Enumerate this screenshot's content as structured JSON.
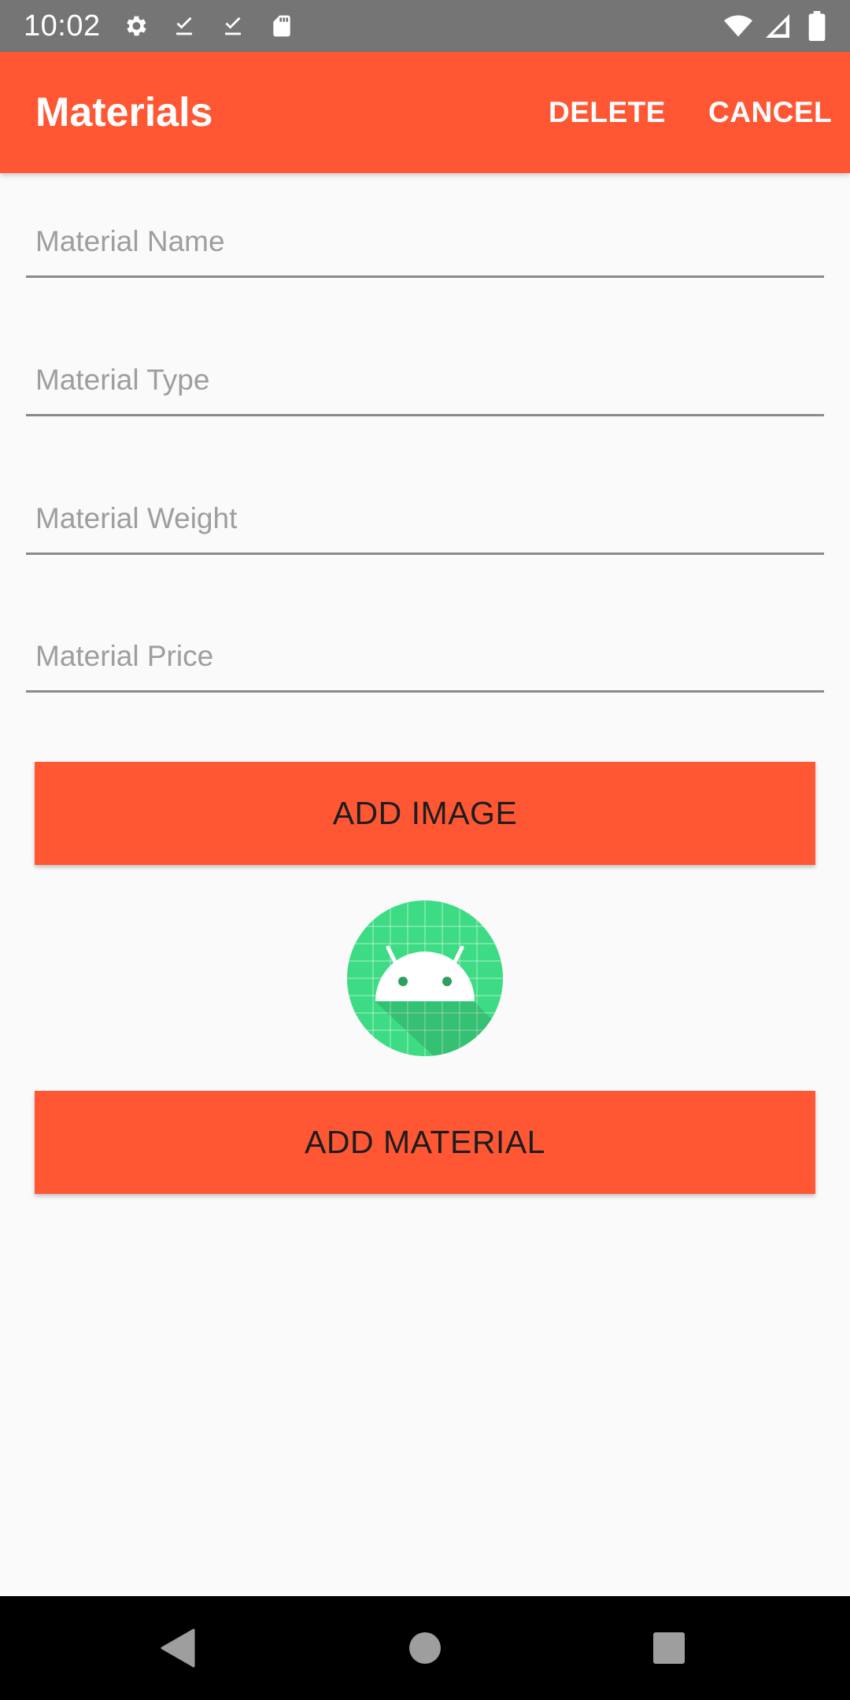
{
  "status_bar": {
    "time": "10:02",
    "icons": [
      "settings-icon",
      "download-done-icon",
      "download-done-icon",
      "sd-card-icon"
    ],
    "right_icons": [
      "wifi-icon",
      "signal-icon",
      "battery-icon"
    ]
  },
  "app_bar": {
    "title": "Materials",
    "delete_label": "DELETE",
    "cancel_label": "CANCEL"
  },
  "form": {
    "name_placeholder": "Material Name",
    "type_placeholder": "Material Type",
    "weight_placeholder": "Material Weight",
    "price_placeholder": "Material Price",
    "name_value": "",
    "type_value": "",
    "weight_value": "",
    "price_value": ""
  },
  "buttons": {
    "add_image_label": "ADD IMAGE",
    "add_material_label": "ADD MATERIAL"
  },
  "image_preview": {
    "icon": "android-icon"
  },
  "nav_bar": {
    "icons": [
      "back-icon",
      "home-icon",
      "recents-icon"
    ]
  },
  "colors": {
    "accent": "#ff5733",
    "status_bar": "#757575",
    "background": "#fafafa",
    "android_green": "#3ddc84"
  }
}
